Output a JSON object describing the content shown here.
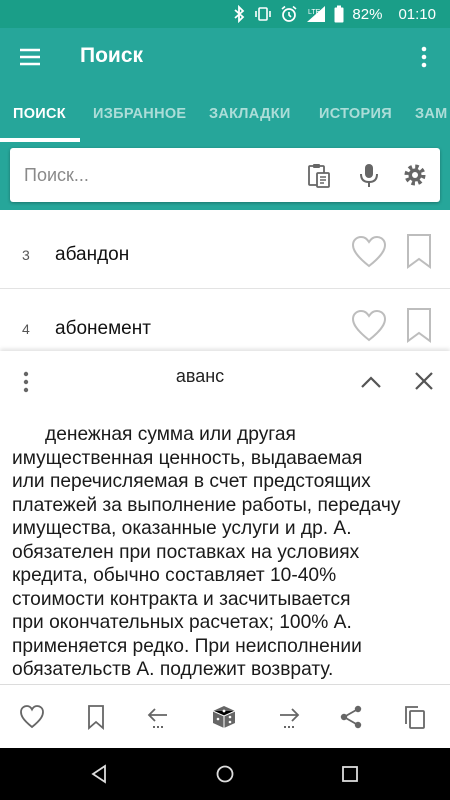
{
  "status_bar": {
    "battery": "82%",
    "time": "01:10",
    "network": "LTE"
  },
  "app_bar": {
    "title": "Поиск"
  },
  "tabs": [
    {
      "label": "ПОИСК"
    },
    {
      "label": "ИЗБРАННОЕ"
    },
    {
      "label": "ЗАКЛАДКИ"
    },
    {
      "label": "ИСТОРИЯ"
    },
    {
      "label": "ЗАМ"
    }
  ],
  "search": {
    "placeholder": "Поиск..."
  },
  "results": [
    {
      "num": "3",
      "word": "абандон"
    },
    {
      "num": "4",
      "word": "абонемент"
    }
  ],
  "panel": {
    "title": "аванс",
    "definition_lines": [
      "денежная сумма или другая",
      "имущественная ценность, выдаваемая",
      "или перечисляемая в счет предстоящих",
      "платежей за выполнение работы, передачу",
      "имущества, оказанные услуги и др. А.",
      "обязателен при поставках на условиях",
      "кредита, обычно составляет 10-40%",
      "стоимости контракта и засчитывается",
      "при окончательных расчетах; 100% А.",
      "применяется редко. При неисполнении",
      "обязательств А. подлежит возврату."
    ]
  },
  "colors": {
    "status_bar": "#1a9e88",
    "primary": "#26a69a",
    "icon_grey": "#666666",
    "outline_grey": "#bdbdbd"
  },
  "icons": {
    "status": [
      "bluetooth-icon",
      "vibrate-icon",
      "alarm-icon",
      "signal-icon",
      "battery-icon"
    ],
    "app_bar": [
      "menu-icon",
      "more-vert-icon"
    ],
    "search": [
      "clipboard-icon",
      "mic-icon",
      "settings-icon"
    ],
    "bottom_bar": [
      "heart-icon",
      "bookmark-icon",
      "back-arrow-icon",
      "dice-icon",
      "forward-arrow-icon",
      "share-icon",
      "copy-icon"
    ]
  }
}
